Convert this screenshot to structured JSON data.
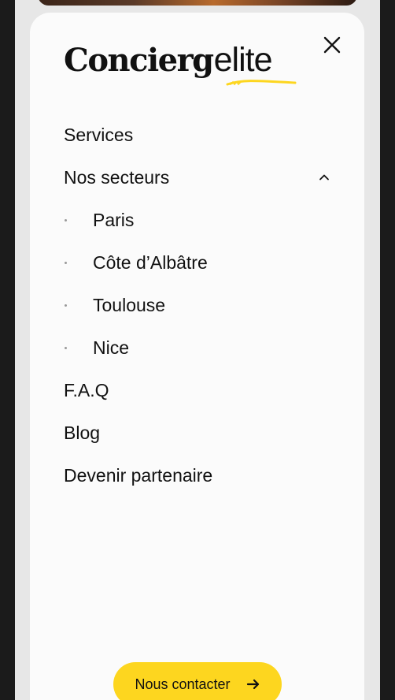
{
  "logo": {
    "main": "Concierg",
    "sub": "elite"
  },
  "icons": {
    "close": "close-icon",
    "chevron": "chevron-up-icon",
    "arrow": "arrow-right-icon"
  },
  "colors": {
    "accent": "#fdd61f",
    "text": "#111111",
    "panel": "#fbfbfb"
  },
  "nav": {
    "services": "Services",
    "sectors": "Nos secteurs",
    "sector_items": [
      "Paris",
      "Côte d’Albâtre",
      "Toulouse",
      "Nice"
    ],
    "faq": "F.A.Q",
    "blog": "Blog",
    "partner": "Devenir partenaire"
  },
  "cta": {
    "label": "Nous contacter"
  }
}
